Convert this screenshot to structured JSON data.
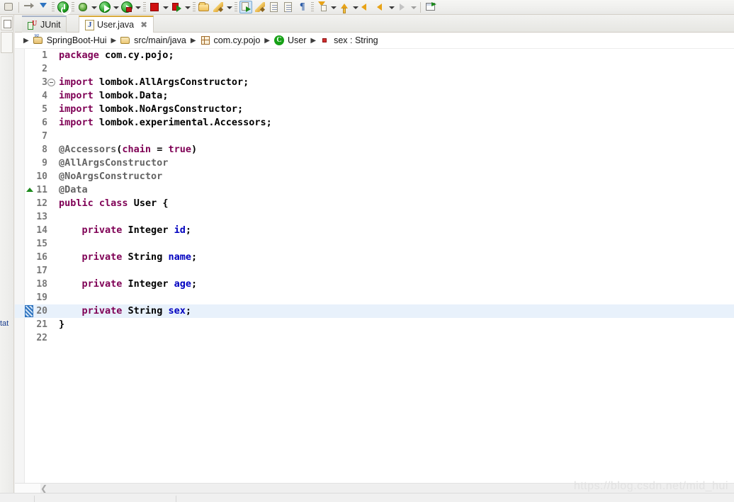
{
  "toolbar": {
    "items": [
      {
        "name": "skip-all-breakpoints-icon",
        "kind": "hand"
      },
      {
        "name": "step-over-icon",
        "kind": "arr-right"
      },
      {
        "name": "step-into-icon",
        "kind": "arr-down-blue"
      },
      {
        "name": "terminate-all-icon",
        "kind": "power-green"
      },
      {
        "name": "debug-icon",
        "kind": "bug"
      },
      {
        "name": "run-icon",
        "kind": "play-green"
      },
      {
        "name": "run-as-server-icon",
        "kind": "play-server"
      },
      {
        "name": "terminate-icon",
        "kind": "stop-red"
      },
      {
        "name": "run-external-tools-icon",
        "kind": "run-ext"
      },
      {
        "name": "open-resource-icon",
        "kind": "folder"
      },
      {
        "name": "new-java-icon",
        "kind": "pencil"
      },
      {
        "name": "search-icon",
        "kind": "doc-blue"
      },
      {
        "name": "toggle-mark-occurrences-icon",
        "kind": "pencil-yellow"
      },
      {
        "name": "next-annotation-icon",
        "kind": "doc-arrow"
      },
      {
        "name": "show-whitespace-icon",
        "kind": "doc-lines"
      },
      {
        "name": "toggle-block-selection-icon",
        "kind": "pilcrow"
      },
      {
        "name": "next-edit-icon",
        "kind": "arrow-down-yellow"
      },
      {
        "name": "previous-edit-icon",
        "kind": "arrow-up-yellow"
      },
      {
        "name": "back-history-icon",
        "kind": "arrow-back"
      },
      {
        "name": "forward-history-icon",
        "kind": "arrow-fwd"
      },
      {
        "name": "forward-disabled-icon",
        "kind": "arrow-fwd-grey"
      },
      {
        "name": "new-window-icon",
        "kind": "window"
      }
    ]
  },
  "left_rail": {
    "bottom_label": "tat"
  },
  "tabs": [
    {
      "label": "JUnit",
      "icon": "junit-icon",
      "active": false,
      "closable": false
    },
    {
      "label": "User.java",
      "icon": "java-file-icon",
      "active": true,
      "closable": true,
      "close_glyph": "✖"
    }
  ],
  "breadcrumb": {
    "separator": "▶",
    "items": [
      {
        "label": "SpringBoot-Hui",
        "icon": "java-project-icon"
      },
      {
        "label": "src/main/java",
        "icon": "source-folder-icon"
      },
      {
        "label": "com.cy.pojo",
        "icon": "package-icon"
      },
      {
        "label": "User",
        "icon": "class-icon",
        "glyph": "C"
      },
      {
        "label": "sex : String",
        "icon": "field-icon"
      }
    ]
  },
  "editor": {
    "file": "User.java",
    "highlight_line": 20,
    "cursor_line": 20,
    "fold_collapse_line": 3,
    "fold_up_line": 11,
    "lines": [
      {
        "n": 1,
        "tokens": [
          {
            "t": "package",
            "c": "kw"
          },
          {
            "t": " com.cy.pojo;",
            "c": "pln"
          }
        ]
      },
      {
        "n": 2,
        "tokens": []
      },
      {
        "n": 3,
        "tokens": [
          {
            "t": "import",
            "c": "kw"
          },
          {
            "t": " lombok.AllArgsConstructor;",
            "c": "pln"
          }
        ]
      },
      {
        "n": 4,
        "tokens": [
          {
            "t": "import",
            "c": "kw"
          },
          {
            "t": " lombok.Data;",
            "c": "pln"
          }
        ]
      },
      {
        "n": 5,
        "tokens": [
          {
            "t": "import",
            "c": "kw"
          },
          {
            "t": " lombok.NoArgsConstructor;",
            "c": "pln"
          }
        ]
      },
      {
        "n": 6,
        "tokens": [
          {
            "t": "import",
            "c": "kw"
          },
          {
            "t": " lombok.experimental.Accessors;",
            "c": "pln"
          }
        ]
      },
      {
        "n": 7,
        "tokens": []
      },
      {
        "n": 8,
        "tokens": [
          {
            "t": "@Accessors",
            "c": "ann"
          },
          {
            "t": "(",
            "c": "punc"
          },
          {
            "t": "chain",
            "c": "kw"
          },
          {
            "t": " = ",
            "c": "punc"
          },
          {
            "t": "true",
            "c": "kw"
          },
          {
            "t": ")",
            "c": "punc"
          }
        ]
      },
      {
        "n": 9,
        "tokens": [
          {
            "t": "@AllArgsConstructor",
            "c": "ann"
          }
        ]
      },
      {
        "n": 10,
        "tokens": [
          {
            "t": "@NoArgsConstructor",
            "c": "ann"
          }
        ]
      },
      {
        "n": 11,
        "tokens": [
          {
            "t": "@Data",
            "c": "ann"
          }
        ]
      },
      {
        "n": 12,
        "tokens": [
          {
            "t": "public",
            "c": "kw"
          },
          {
            "t": " ",
            "c": "pln"
          },
          {
            "t": "class",
            "c": "kw"
          },
          {
            "t": " User {",
            "c": "pln"
          }
        ]
      },
      {
        "n": 13,
        "tokens": []
      },
      {
        "n": 14,
        "tokens": [
          {
            "t": "    ",
            "c": "pln"
          },
          {
            "t": "private",
            "c": "kw"
          },
          {
            "t": " Integer ",
            "c": "pln"
          },
          {
            "t": "id",
            "c": "fld"
          },
          {
            "t": ";",
            "c": "punc"
          }
        ]
      },
      {
        "n": 15,
        "tokens": []
      },
      {
        "n": 16,
        "tokens": [
          {
            "t": "    ",
            "c": "pln"
          },
          {
            "t": "private",
            "c": "kw"
          },
          {
            "t": " String ",
            "c": "pln"
          },
          {
            "t": "name",
            "c": "fld"
          },
          {
            "t": ";",
            "c": "punc"
          }
        ]
      },
      {
        "n": 17,
        "tokens": []
      },
      {
        "n": 18,
        "tokens": [
          {
            "t": "    ",
            "c": "pln"
          },
          {
            "t": "private",
            "c": "kw"
          },
          {
            "t": " Integer ",
            "c": "pln"
          },
          {
            "t": "age",
            "c": "fld"
          },
          {
            "t": ";",
            "c": "punc"
          }
        ]
      },
      {
        "n": 19,
        "tokens": []
      },
      {
        "n": 20,
        "tokens": [
          {
            "t": "    ",
            "c": "pln"
          },
          {
            "t": "private",
            "c": "kw"
          },
          {
            "t": " String ",
            "c": "pln"
          },
          {
            "t": "sex",
            "c": "fld"
          },
          {
            "t": ";",
            "c": "punc"
          }
        ]
      },
      {
        "n": 21,
        "tokens": [
          {
            "t": "}",
            "c": "pln"
          }
        ]
      },
      {
        "n": 22,
        "tokens": []
      }
    ]
  },
  "scrollbar": {
    "left_arrow": "❮"
  },
  "watermark": {
    "text": "https://blog.csdn.net/mid_hui"
  },
  "colors": {
    "keyword": "#7f0055",
    "annotation": "#646464",
    "field": "#0000c0",
    "plain": "#000000",
    "line_number": "#787878",
    "highlight_line_bg": "#e8f1fb",
    "active_tab_border": "#d8a93a",
    "editor_bg": "#ffffff",
    "chrome_bg": "#f0f0f0"
  }
}
